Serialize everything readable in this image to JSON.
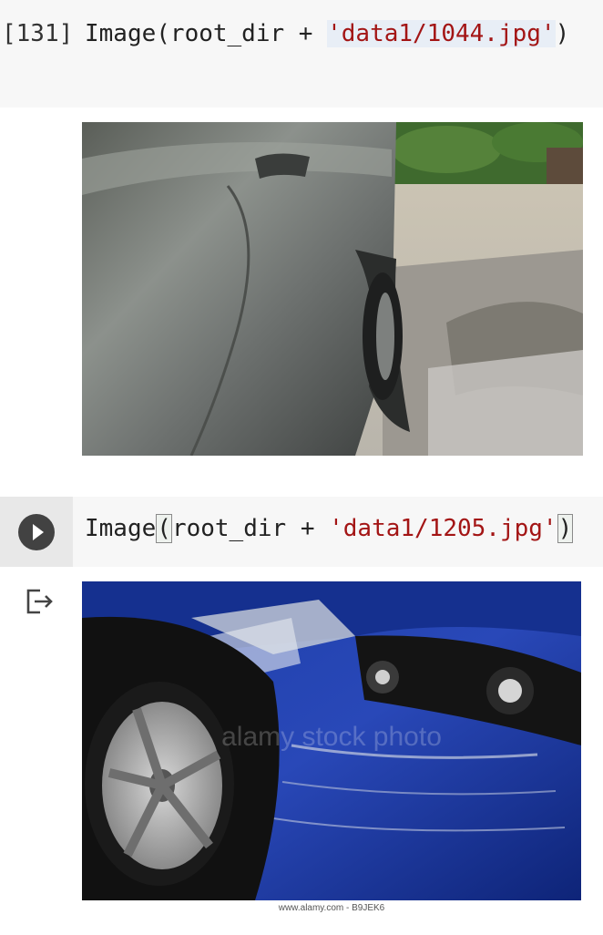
{
  "cell1": {
    "exec_count": "[131]",
    "code_pre": "Image(root_dir + ",
    "code_str": "'data1/1044.jpg'",
    "code_post": ")"
  },
  "cell2": {
    "code_pre": "Image",
    "code_open": "(",
    "code_mid": "root_dir + ",
    "code_str": "'data1/1205.jpg'",
    "code_close": ")"
  },
  "output2": {
    "watermark_text": "alamy stock photo",
    "credit": "www.alamy.com - B9JEK6"
  },
  "colors": {
    "string": "#a31515",
    "run_button": "#424242",
    "cell_bg": "#f7f7f7"
  },
  "icons": {
    "run": "play-circle-icon",
    "output": "output-redirect-icon"
  }
}
